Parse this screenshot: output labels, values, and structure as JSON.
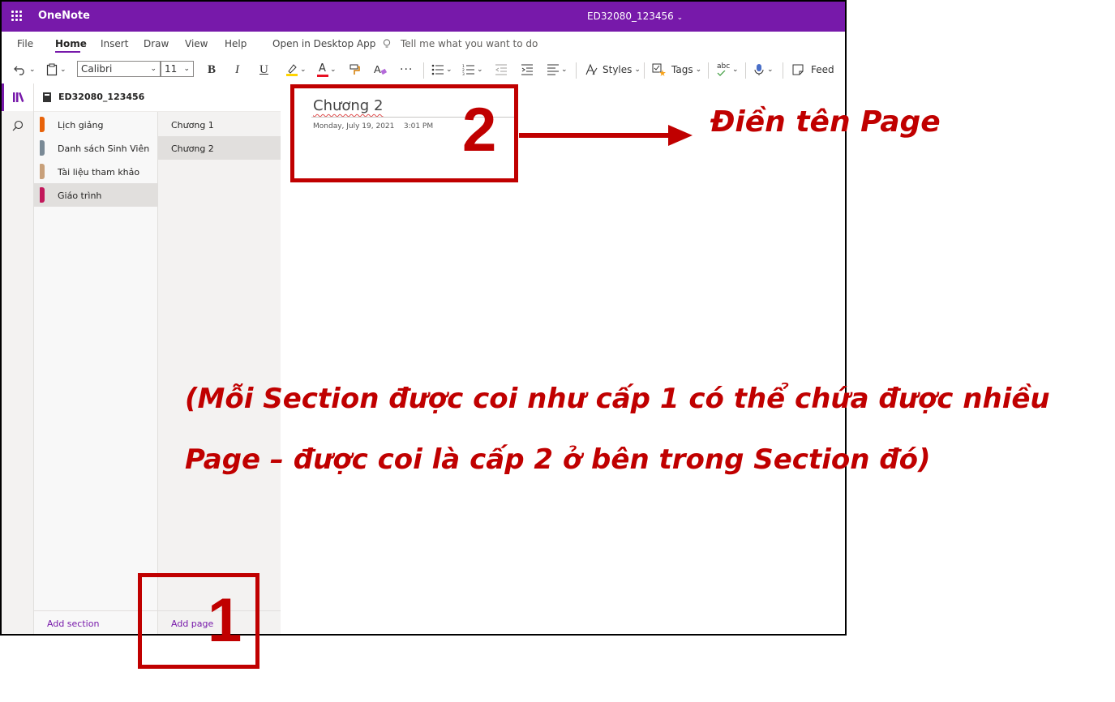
{
  "app": {
    "name": "OneNote",
    "notebook_title": "ED32080_123456"
  },
  "menu": {
    "tabs": [
      "File",
      "Home",
      "Insert",
      "Draw",
      "View",
      "Help"
    ],
    "open_desktop": "Open in Desktop App",
    "tell_me_placeholder": "Tell me what you want to do"
  },
  "toolbar": {
    "font_name": "Calibri",
    "font_size": "11",
    "bold": "B",
    "italic": "I",
    "underline": "U",
    "font_color_glyph": "A",
    "more": "···",
    "styles": "Styles",
    "tags": "Tags",
    "spell": "abc",
    "feed": "Feed"
  },
  "navigator": {
    "notebook": "ED32080_123456",
    "sections": [
      {
        "label": "Lịch giảng",
        "color": "#e8630a"
      },
      {
        "label": "Danh sách Sinh Viên",
        "color": "#7a8a96"
      },
      {
        "label": "Tài liệu tham khảo",
        "color": "#c8a07a"
      },
      {
        "label": "Giáo trình",
        "color": "#c2185b"
      }
    ],
    "pages": [
      "Chương 1",
      "Chương 2"
    ],
    "add_section": "Add section",
    "add_page": "Add page"
  },
  "canvas": {
    "page_title": "Chương 2",
    "date": "Monday, July 19, 2021",
    "time": "3:01 PM"
  },
  "annotations": {
    "number_1": "1",
    "number_2": "2",
    "label_page": "Điền tên Page",
    "note_line1": "(Mỗi Section được coi như cấp 1 có thể chứa được nhiều",
    "note_line2": "Page – được coi là cấp 2 ở bên trong Section đó)",
    "color": "#c00000"
  },
  "colors": {
    "brand": "#7719aa",
    "accent_red": "#c00000"
  }
}
